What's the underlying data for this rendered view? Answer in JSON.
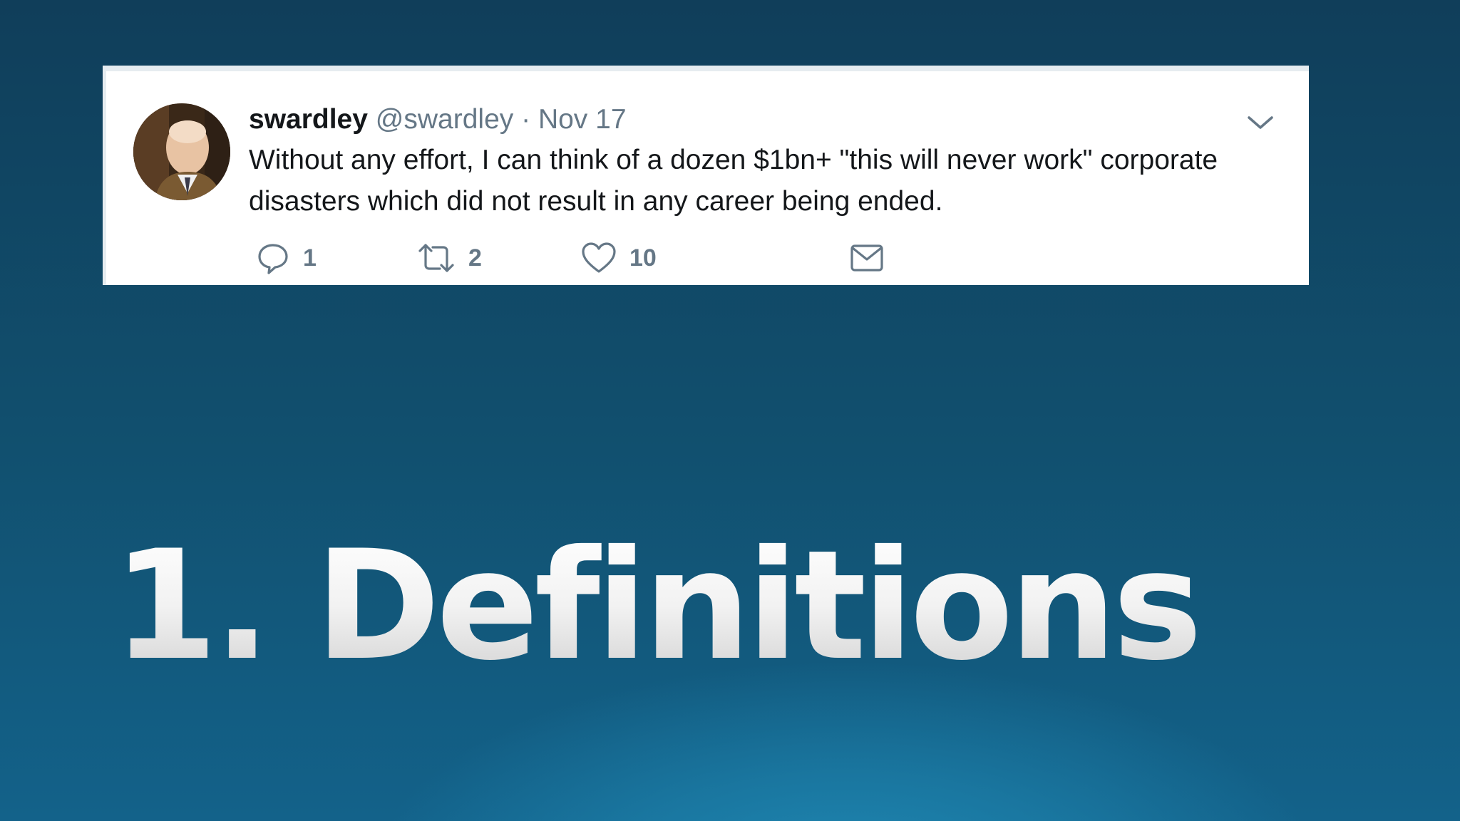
{
  "tweet": {
    "display_name": "swardley",
    "handle": "@swardley",
    "separator": "·",
    "date": "Nov 17",
    "text": "Without any effort, I can think of a dozen $1bn+ \"this will never work\" corporate disasters which did not result in any career being ended.",
    "actions": {
      "reply_count": "1",
      "retweet_count": "2",
      "like_count": "10"
    },
    "icons": [
      "avatar",
      "chevron-down-icon",
      "reply-icon",
      "retweet-icon",
      "heart-icon",
      "mail-icon"
    ],
    "colors": {
      "text": "#14171a",
      "muted": "#657786"
    }
  },
  "slide": {
    "title": "1. Definitions",
    "background_colors": [
      "#103e5a",
      "#13628a",
      "#1f88b3"
    ]
  }
}
